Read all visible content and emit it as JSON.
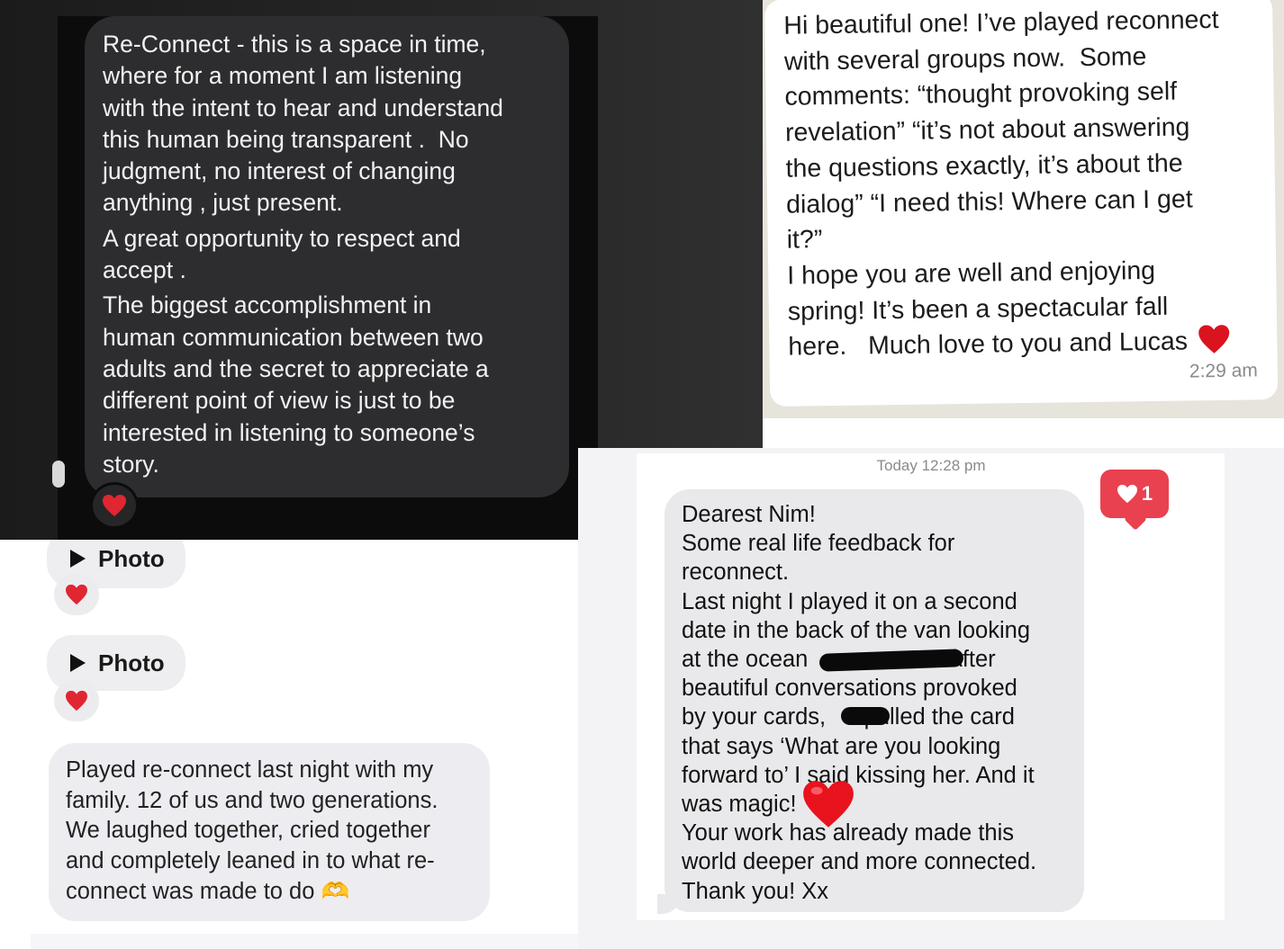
{
  "panel_dark": {
    "paragraphs": [
      "Re-Connect - this is a space in time,\nwhere for a moment I am listening\nwith the intent to hear and understand\nthis human being transparent .  No\njudgment, no interest of changing\nanything , just present.",
      "A great opportunity to respect and\naccept .",
      "The biggest accomplishment in\nhuman communication between two\nadults and the secret to appreciate a\ndifferent point of view is just to be\ninterested in listening to someone’s\nstory."
    ],
    "reaction": "❤️"
  },
  "panel_whatsapp": {
    "paragraphs": [
      "Hi beautiful one! I’ve played reconnect\nwith several groups now.  Some\ncomments: “thought provoking self\nrevelation” “it’s not about answering\nthe questions exactly, it’s about the\ndialog” “I need this! Where can I get\nit?”",
      "I hope you are well and enjoying\nspring! It’s been a spectacular fall\nhere.   Much love to you and Lucas"
    ],
    "emoji": "❤️",
    "time": "2:29 am"
  },
  "panel_family": {
    "photo_label_1": "Photo",
    "photo_label_2": "Photo",
    "reaction": "❤️",
    "message": "Played re-connect last night with my\nfamily. 12 of us and two generations.\nWe laughed together, cried together\nand completely leaned in to what re-\nconnect was made to do",
    "emoji": "🫶"
  },
  "panel_imessage": {
    "timestamp": "Today 12:28 pm",
    "like_count": "1",
    "lines": [
      "Dearest Nim!",
      "Some real life feedback for",
      "reconnect.",
      "Last night I played it on a second",
      "date in the back of the van looking",
      "at the ocean                      After",
      "beautiful conversations provoked",
      "by your cards,      pulled the card",
      "that says ‘What are you looking",
      "forward to’ I said kissing her. And it",
      "was magic!",
      "Your work has already made this",
      "world deeper and more connected.",
      "Thank you! Xx"
    ],
    "heart_emoji": "❤️"
  },
  "colors": {
    "dark_bubble": "#2d2d2f",
    "like_badge": "#e9414f",
    "imessage_gray": "#e9e9eb"
  }
}
